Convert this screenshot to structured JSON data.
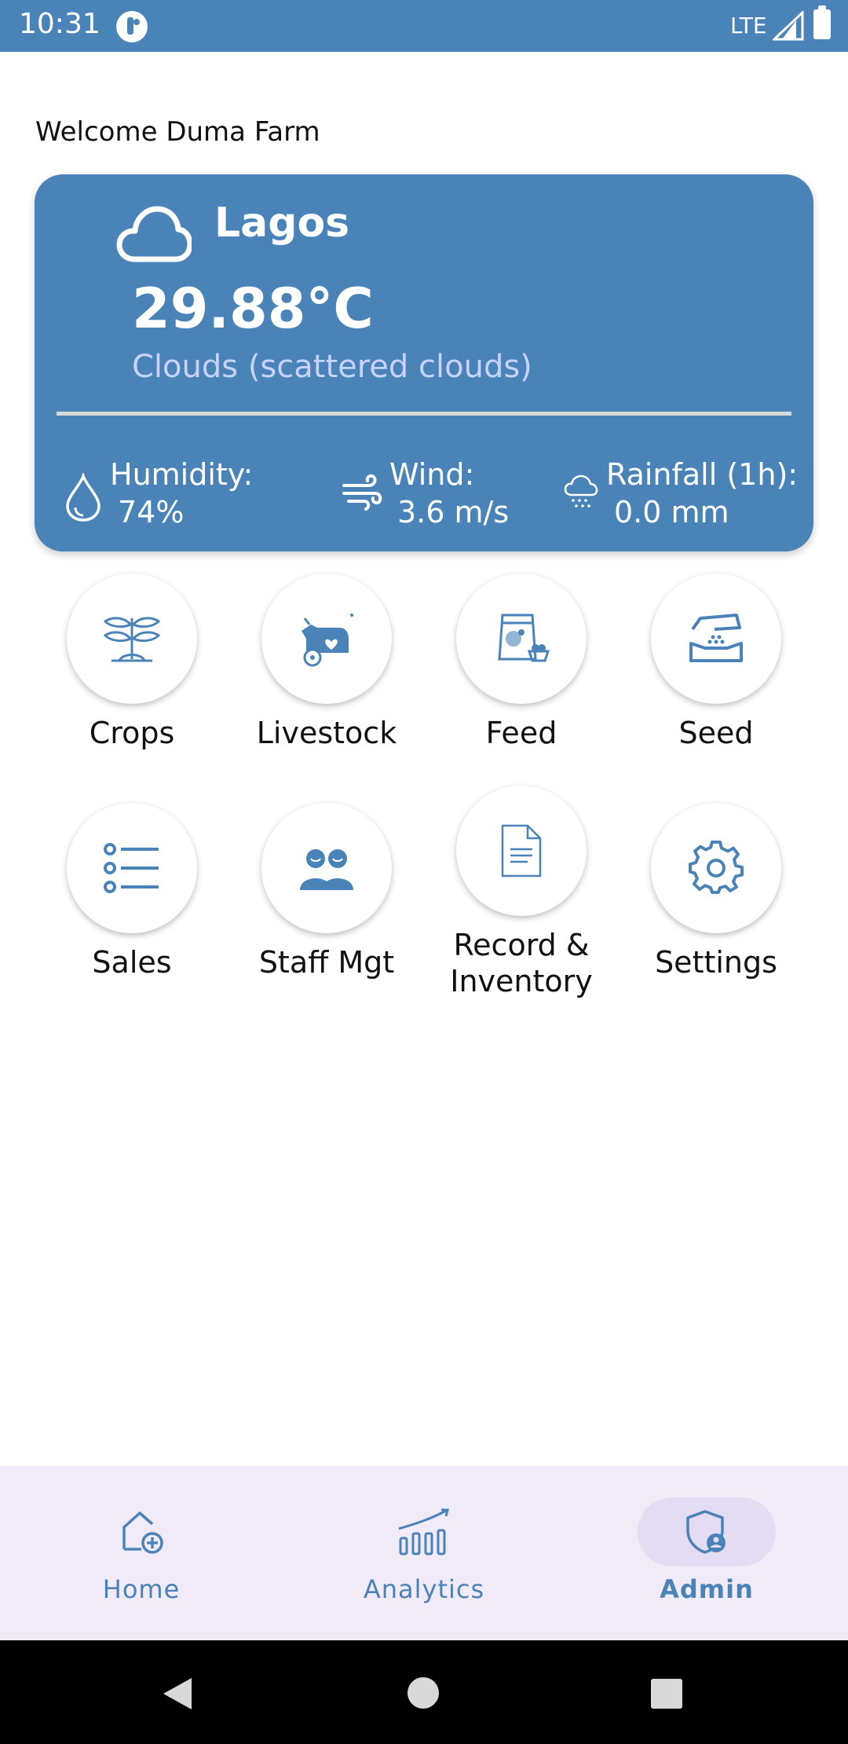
{
  "status_bar": {
    "time": "10:31",
    "network": "LTE"
  },
  "welcome": "Welcome  Duma Farm",
  "weather": {
    "city": "Lagos",
    "temperature": "29.88°C",
    "description": "Clouds (scattered clouds)",
    "humidity_label": "Humidity:",
    "humidity_value": "74%",
    "wind_label": "Wind:",
    "wind_value": "3.6 m/s",
    "rain_label": "Rainfall (1h):",
    "rain_value": "0.0 mm"
  },
  "features": [
    {
      "label": "Crops",
      "icon": "crops-icon"
    },
    {
      "label": "Livestock",
      "icon": "livestock-icon"
    },
    {
      "label": "Feed",
      "icon": "feed-icon"
    },
    {
      "label": "Seed",
      "icon": "seed-icon"
    },
    {
      "label": "Sales",
      "icon": "sales-list-icon"
    },
    {
      "label": "Staff Mgt",
      "icon": "staff-icon"
    },
    {
      "label": "Record & Inventory",
      "icon": "document-icon"
    },
    {
      "label": "Settings",
      "icon": "gear-icon"
    }
  ],
  "bottom_nav": [
    {
      "label": "Home",
      "icon": "home-add-icon",
      "active": false
    },
    {
      "label": "Analytics",
      "icon": "analytics-icon",
      "active": false
    },
    {
      "label": "Admin",
      "icon": "admin-shield-icon",
      "active": true
    }
  ],
  "colors": {
    "primary": "#4a83b8",
    "nav_bg": "#f1ebf7",
    "active_pill": "#e3dcf3",
    "desc_text": "#c9d2ff"
  }
}
